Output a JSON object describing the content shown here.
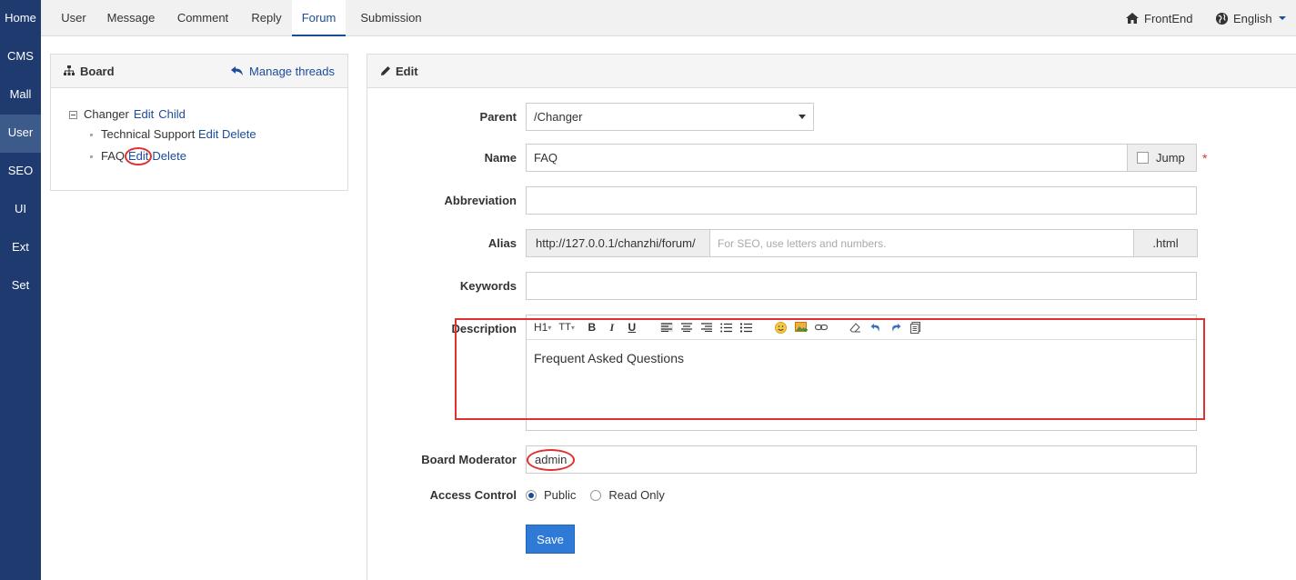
{
  "leftnav": [
    "Home",
    "CMS",
    "Mall",
    "User",
    "SEO",
    "UI",
    "Ext",
    "Set"
  ],
  "tabs": [
    "User",
    "Message",
    "Comment",
    "Reply",
    "Forum",
    "Submission"
  ],
  "topright": {
    "frontend": "FrontEnd",
    "language": "English"
  },
  "board": {
    "title": "Board",
    "manage": "Manage threads",
    "root": {
      "name": "Changer",
      "edit": "Edit",
      "child": "Child"
    },
    "children": [
      {
        "name": "Technical Support",
        "edit": "Edit",
        "delete": "Delete"
      },
      {
        "name": "FAQ",
        "edit": "Edit",
        "delete": "Delete"
      }
    ]
  },
  "edit": {
    "title": "Edit",
    "parent_label": "Parent",
    "parent_value": "/Changer",
    "name_label": "Name",
    "name_value": "FAQ",
    "jump_label": "Jump",
    "required": "*",
    "abbr_label": "Abbreviation",
    "abbr_value": "",
    "alias_label": "Alias",
    "alias_prefix": "http://127.0.0.1/chanzhi/forum/",
    "alias_placeholder": "For SEO, use letters and numbers.",
    "alias_suffix": ".html",
    "keywords_label": "Keywords",
    "keywords_value": "",
    "desc_label": "Description",
    "desc_value": "Frequent Asked Questions",
    "moderator_label": "Board Moderator",
    "moderator_value": "admin",
    "access_label": "Access Control",
    "access_options": [
      "Public",
      "Read Only"
    ],
    "access_selected": "Public",
    "save": "Save"
  },
  "toolbar": {
    "heading": "H1",
    "fontsize": "TT",
    "bold": "B",
    "italic": "I",
    "underline": "U"
  },
  "colors": {
    "nav": "#1e3a6e",
    "accent": "#1a4b9c",
    "annotation": "#e03030",
    "save": "#2e7ad6"
  }
}
